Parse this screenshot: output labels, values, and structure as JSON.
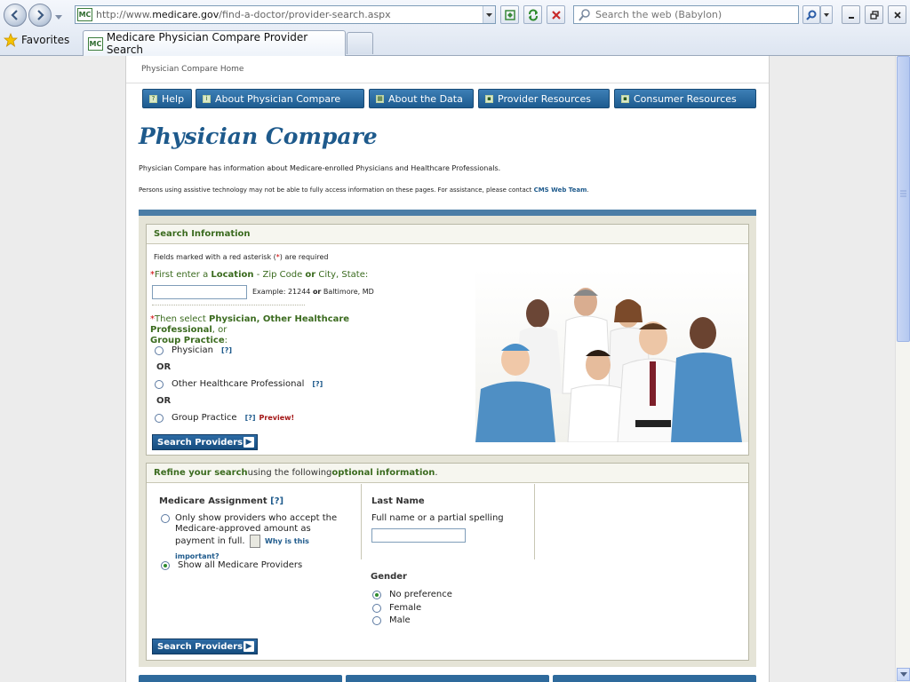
{
  "browser": {
    "url_prefix": "http://www.",
    "url_domain": "medicare.gov",
    "url_path": "/find-a-doctor/provider-search.aspx",
    "search_placeholder": "Search the web (Babylon)",
    "favorites_label": "Favorites",
    "tab_title": "Medicare Physician Compare Provider Search",
    "favicon_text": "MC"
  },
  "page": {
    "breadcrumb": "Physician Compare Home",
    "nav": [
      {
        "label": "Help",
        "icon": "?"
      },
      {
        "label": "About Physician Compare",
        "icon": "i"
      },
      {
        "label": "About the Data",
        "icon": "▦"
      },
      {
        "label": "Provider Resources",
        "icon": "▪"
      },
      {
        "label": "Consumer Resources",
        "icon": "▪"
      }
    ],
    "title": "Physician Compare",
    "intro": "Physician Compare has information about Medicare-enrolled Physicians and Healthcare Professionals.",
    "assist_text": "Persons using assistive technology may not be able to fully access information on these pages. For assistance, please contact ",
    "assist_link": "CMS Web Team",
    "assist_end": "."
  },
  "search_info": {
    "heading": "Search Information",
    "required_note_a": "Fields marked with a red asterisk (",
    "required_note_ast": "*",
    "required_note_b": ") are required",
    "location_prefix": "First enter a ",
    "location_bold": "Location",
    "location_mid": " - Zip Code ",
    "location_or": "or",
    "location_end": " City, State:",
    "location_value": "",
    "example_a": "Example: 21244 ",
    "example_or": "or",
    "example_b": " Baltimore, MD",
    "select_prefix": "Then select ",
    "select_bold": "Physician, Other Healthcare Professional",
    "select_or": ", or",
    "select_bold2": "Group Practice",
    "select_end": ":",
    "options": [
      {
        "label": "Physician",
        "help": "[?]",
        "extra": ""
      },
      {
        "label": "Other Healthcare Professional",
        "help": "[?]",
        "extra": ""
      },
      {
        "label": "Group Practice",
        "help": "[?]",
        "extra": "Preview!"
      }
    ],
    "or_label": "OR",
    "button": "Search Providers"
  },
  "refine": {
    "heading_a": "Refine your search",
    "heading_b": " using the following ",
    "heading_c": "optional information",
    "heading_d": ".",
    "assignment_label": "Medicare Assignment",
    "assignment_help": "[?]",
    "assignment_opt1": "Only show providers who accept the Medicare-approved amount as payment in full.",
    "why_link": "Why is this important?",
    "assignment_opt2": "Show all Medicare Providers",
    "lastname_label": "Last Name",
    "lastname_hint": "Full name or a partial spelling",
    "lastname_value": "",
    "gender_label": "Gender",
    "gender_options": [
      "No preference",
      "Female",
      "Male"
    ],
    "button": "Search Providers"
  },
  "colors": {
    "brand_blue": "#1e5a8c",
    "label_green": "#3b6b1f",
    "panel_beige": "#e5e4d7"
  }
}
